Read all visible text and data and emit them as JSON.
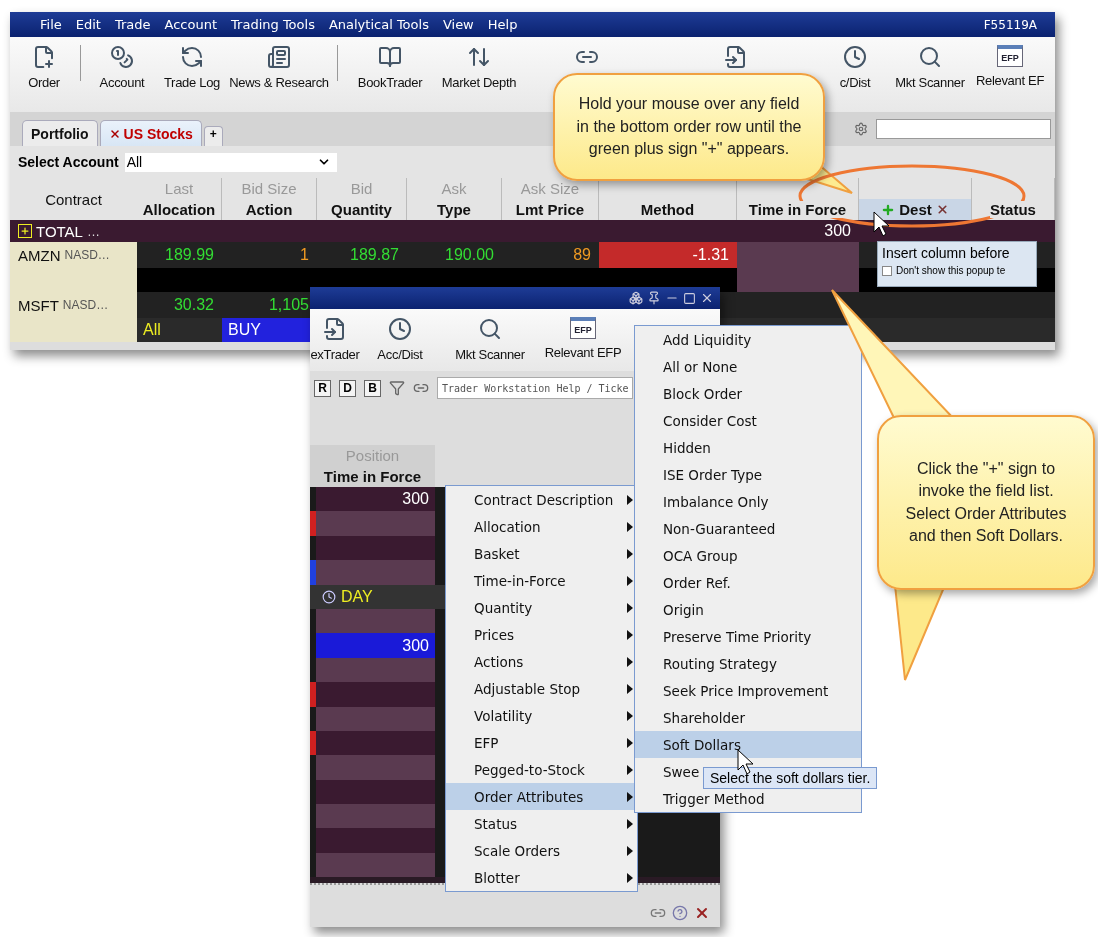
{
  "main_window": {
    "menu": [
      "File",
      "Edit",
      "Trade",
      "Account",
      "Trading Tools",
      "Analytical Tools",
      "View",
      "Help"
    ],
    "account_id": "F55119A",
    "toolbar": [
      {
        "kind": "order",
        "label": "Order"
      },
      {
        "kind": "separator"
      },
      {
        "kind": "account",
        "label": "Account"
      },
      {
        "kind": "tradelog",
        "label": "Trade Log"
      },
      {
        "kind": "news",
        "label": "News & Research"
      },
      {
        "kind": "separator"
      },
      {
        "kind": "book",
        "label": "BookTrader"
      },
      {
        "kind": "depth",
        "label": "Market Depth"
      },
      {
        "kind": "link"
      },
      {
        "kind": "export"
      },
      {
        "kind": "clock",
        "label": "c/Dist"
      },
      {
        "kind": "scanner",
        "label": "Mkt Scanner"
      },
      {
        "kind": "efp",
        "label": "Relevant EF",
        "badge": "EFP"
      }
    ],
    "tabs": [
      {
        "label": "Portfolio",
        "selected": false,
        "closable": false
      },
      {
        "label": "US Stocks",
        "selected": true,
        "closable": true
      }
    ],
    "add_tab": "+",
    "select_account": {
      "label": "Select Account",
      "value": "All"
    },
    "contract_header": "Contract",
    "upper_headers": [
      "Last",
      "Bid Size",
      "Bid",
      "Ask",
      "Ask Size"
    ],
    "columns": [
      {
        "label": "Allocation"
      },
      {
        "label": "Action"
      },
      {
        "label": "Quantity"
      },
      {
        "label": "Type"
      },
      {
        "label": "Lmt Price"
      },
      {
        "label": "Method"
      },
      {
        "label": "Time in Force"
      },
      {
        "label": "Dest",
        "selected": true
      },
      {
        "label": "Status",
        "selected": false
      }
    ],
    "rows": [
      {
        "kind": "total",
        "contract": "TOTAL",
        "exchange": "…",
        "cells": [
          {},
          {},
          {},
          {},
          {},
          {},
          {
            "text": "300"
          },
          {},
          {}
        ]
      },
      {
        "kind": "quote",
        "contract": "AMZN",
        "exchange": "NASD…",
        "cells": [
          {
            "text": "189.99",
            "color": "#33dd33"
          },
          {
            "text": "1",
            "color": "#ee9922"
          },
          {
            "text": "189.87",
            "color": "#33dd33"
          },
          {
            "text": "190.00",
            "color": "#33dd33"
          },
          {
            "text": "89",
            "color": "#ee9922"
          },
          {
            "text": "-1.31",
            "kind": "down"
          },
          {
            "kind": "order"
          },
          {},
          {}
        ]
      },
      {
        "kind": "blank",
        "cells": [
          {},
          {},
          {},
          {},
          {},
          {},
          {
            "kind": "order"
          },
          {},
          {}
        ]
      },
      {
        "kind": "quote",
        "contract": "MSFT",
        "exchange": "NASD…",
        "cells": [
          {
            "text": "30.32",
            "color": "#33dd33"
          },
          {
            "text": "1,105",
            "color": "#33dd33"
          },
          {},
          {},
          {},
          {},
          {},
          {},
          {}
        ]
      },
      {
        "kind": "order",
        "cells": [
          {
            "text": "All",
            "color": "#eeee22"
          },
          {
            "text": "BUY",
            "kind": "buy"
          },
          {},
          {},
          {},
          {},
          {},
          {},
          {}
        ]
      }
    ],
    "popup": {
      "text": "Insert column before",
      "checkbox_label": "Don't show this popup te",
      "checked": false
    }
  },
  "second_window": {
    "toolbar": [
      {
        "kind": "export",
        "label": "exTrader"
      },
      {
        "kind": "clock",
        "label": "Acc/Dist"
      },
      {
        "kind": "scanner",
        "label": "Mkt Scanner"
      },
      {
        "kind": "efp",
        "label": "Relevant EFP",
        "badge": "EFP"
      }
    ],
    "filters": [
      "R",
      "D",
      "B"
    ],
    "search": {
      "placeholder": "Trader Workstation Help / Ticke"
    },
    "upper_header": "Position",
    "column": "Time in Force",
    "rows": [
      {
        "kind": "total",
        "text": "300"
      },
      {
        "kind": "light",
        "color": "#d02020"
      },
      {
        "kind": "dark"
      },
      {
        "kind": "light",
        "color": "#2040e0"
      },
      {
        "kind": "day",
        "text": "DAY"
      },
      {
        "kind": "light"
      },
      {
        "kind": "selected",
        "text": "300"
      },
      {
        "kind": "light"
      },
      {
        "kind": "dark",
        "color": "#d02020"
      },
      {
        "kind": "light"
      },
      {
        "kind": "dark",
        "color": "#d02020"
      },
      {
        "kind": "light"
      },
      {
        "kind": "dark"
      },
      {
        "kind": "light"
      },
      {
        "kind": "dark"
      },
      {
        "kind": "light"
      }
    ]
  },
  "field_menu": [
    {
      "label": "Contract Description",
      "selected": false
    },
    {
      "label": "Allocation",
      "selected": false
    },
    {
      "label": "Basket",
      "selected": false
    },
    {
      "label": "Time-in-Force",
      "selected": false
    },
    {
      "label": "Quantity",
      "selected": false
    },
    {
      "label": "Prices",
      "selected": false
    },
    {
      "label": "Actions",
      "selected": false
    },
    {
      "label": "Adjustable Stop",
      "selected": false
    },
    {
      "label": "Volatility",
      "selected": false
    },
    {
      "label": "EFP",
      "selected": false
    },
    {
      "label": "Pegged-to-Stock",
      "selected": false
    },
    {
      "label": "Order Attributes",
      "selected": true
    },
    {
      "label": "Status",
      "selected": false
    },
    {
      "label": "Scale Orders",
      "selected": false
    },
    {
      "label": "Blotter",
      "selected": false
    }
  ],
  "attributes_menu": [
    {
      "label": "Add Liquidity",
      "selected": false
    },
    {
      "label": "All or None",
      "selected": false
    },
    {
      "label": "Block Order",
      "selected": false
    },
    {
      "label": "Consider Cost",
      "selected": false
    },
    {
      "label": "Hidden",
      "selected": false
    },
    {
      "label": "ISE Order Type",
      "selected": false
    },
    {
      "label": "Imbalance Only",
      "selected": false
    },
    {
      "label": "Non-Guaranteed",
      "selected": false
    },
    {
      "label": "OCA Group",
      "selected": false
    },
    {
      "label": "Order Ref.",
      "selected": false
    },
    {
      "label": "Origin",
      "selected": false
    },
    {
      "label": "Preserve Time Priority",
      "selected": false
    },
    {
      "label": "Routing Strategy",
      "selected": false
    },
    {
      "label": "Seek Price Improvement",
      "selected": false
    },
    {
      "label": "Shareholder",
      "selected": false
    },
    {
      "label": "Soft Dollars",
      "selected": true
    },
    {
      "label": "Swee",
      "selected": false
    },
    {
      "label": "Trigger Method",
      "selected": false
    }
  ],
  "tooltip": "Select the soft dollars tier.",
  "callouts": [
    "Hold your mouse over any field in the bottom order row until the green plus sign \"+\" appears.",
    "Click the \"+\" sign to invoke the field list. Select Order Attributes and then Soft Dollars."
  ]
}
